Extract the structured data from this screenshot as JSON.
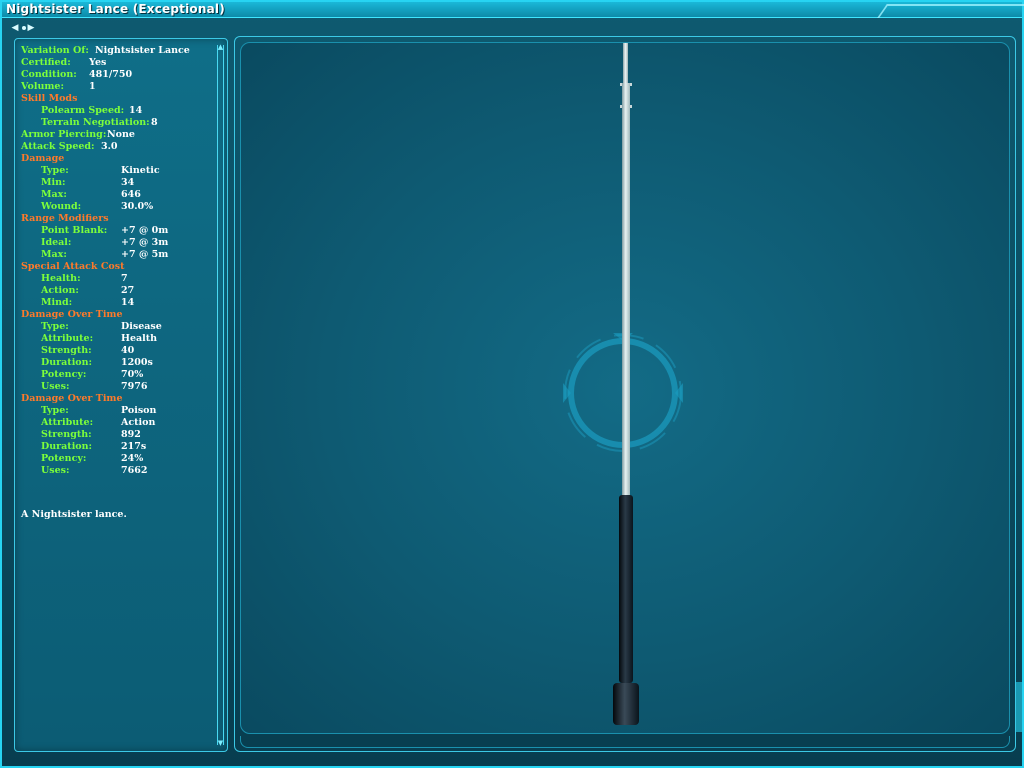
{
  "window": {
    "title": "Nightsister Lance (Exceptional)"
  },
  "toolbar": {
    "prev_icon": "left-arrow-icon",
    "next_icon": "right-arrow-icon"
  },
  "attributes": [
    {
      "kind": "pair",
      "level": 0,
      "label": "Variation Of:",
      "value": "Nightsister Lance",
      "vx": 74
    },
    {
      "kind": "pair",
      "level": 0,
      "label": "Certified:",
      "value": "Yes",
      "vx": 68
    },
    {
      "kind": "pair",
      "level": 0,
      "label": "Condition:",
      "value": "481/750",
      "vx": 68
    },
    {
      "kind": "pair",
      "level": 0,
      "label": "Volume:",
      "value": "1",
      "vx": 68
    },
    {
      "kind": "section",
      "label": "Skill Mods"
    },
    {
      "kind": "pair",
      "level": 1,
      "label": "Polearm Speed:",
      "value": "14",
      "vx": 108
    },
    {
      "kind": "pair",
      "level": 1,
      "label": "Terrain Negotiation:",
      "value": "8",
      "vx": 130
    },
    {
      "kind": "pair",
      "level": 0,
      "label": "Armor Piercing:",
      "value": "None",
      "vx": 86
    },
    {
      "kind": "pair",
      "level": 0,
      "label": "Attack Speed:",
      "value": "3.0",
      "vx": 80
    },
    {
      "kind": "section",
      "label": "Damage"
    },
    {
      "kind": "pair",
      "level": 1,
      "label": "Type:",
      "value": "Kinetic",
      "vx": 100
    },
    {
      "kind": "pair",
      "level": 1,
      "label": "Min:",
      "value": "34",
      "vx": 100
    },
    {
      "kind": "pair",
      "level": 1,
      "label": "Max:",
      "value": "646",
      "vx": 100
    },
    {
      "kind": "pair",
      "level": 1,
      "label": "Wound:",
      "value": "30.0%",
      "vx": 100
    },
    {
      "kind": "section",
      "label": "Range Modifiers"
    },
    {
      "kind": "pair",
      "level": 1,
      "label": "Point Blank:",
      "value": "+7  @  0m",
      "vx": 100
    },
    {
      "kind": "pair",
      "level": 1,
      "label": "Ideal:",
      "value": "+7  @  3m",
      "vx": 100
    },
    {
      "kind": "pair",
      "level": 1,
      "label": "Max:",
      "value": "+7  @  5m",
      "vx": 100
    },
    {
      "kind": "section",
      "label": "Special Attack Cost"
    },
    {
      "kind": "pair",
      "level": 1,
      "label": "Health:",
      "value": "7",
      "vx": 100
    },
    {
      "kind": "pair",
      "level": 1,
      "label": "Action:",
      "value": "27",
      "vx": 100
    },
    {
      "kind": "pair",
      "level": 1,
      "label": "Mind:",
      "value": "14",
      "vx": 100
    },
    {
      "kind": "section",
      "label": "Damage Over Time"
    },
    {
      "kind": "pair",
      "level": 1,
      "label": "Type:",
      "value": "Disease",
      "vx": 100
    },
    {
      "kind": "pair",
      "level": 1,
      "label": "Attribute:",
      "value": "Health",
      "vx": 100
    },
    {
      "kind": "pair",
      "level": 1,
      "label": "Strength:",
      "value": "40",
      "vx": 100
    },
    {
      "kind": "pair",
      "level": 1,
      "label": "Duration:",
      "value": "1200s",
      "vx": 100
    },
    {
      "kind": "pair",
      "level": 1,
      "label": "Potency:",
      "value": "70%",
      "vx": 100
    },
    {
      "kind": "pair",
      "level": 1,
      "label": "Uses:",
      "value": "7976",
      "vx": 100
    },
    {
      "kind": "section",
      "label": "Damage Over Time"
    },
    {
      "kind": "pair",
      "level": 1,
      "label": "Type:",
      "value": "Poison",
      "vx": 100
    },
    {
      "kind": "pair",
      "level": 1,
      "label": "Attribute:",
      "value": "Action",
      "vx": 100
    },
    {
      "kind": "pair",
      "level": 1,
      "label": "Strength:",
      "value": "892",
      "vx": 100
    },
    {
      "kind": "pair",
      "level": 1,
      "label": "Duration:",
      "value": "217s",
      "vx": 100
    },
    {
      "kind": "pair",
      "level": 1,
      "label": "Potency:",
      "value": "24%",
      "vx": 100
    },
    {
      "kind": "pair",
      "level": 1,
      "label": "Uses:",
      "value": "7662",
      "vx": 100
    }
  ],
  "description": "A Nightsister lance.",
  "colors": {
    "label": "#7cff3a",
    "section": "#ff7a2a",
    "value": "#ffffff",
    "frame": "#27d4f2"
  },
  "viewer": {
    "object_icon": "lance-model",
    "reticle_icon": "reticle-ring-icon"
  }
}
